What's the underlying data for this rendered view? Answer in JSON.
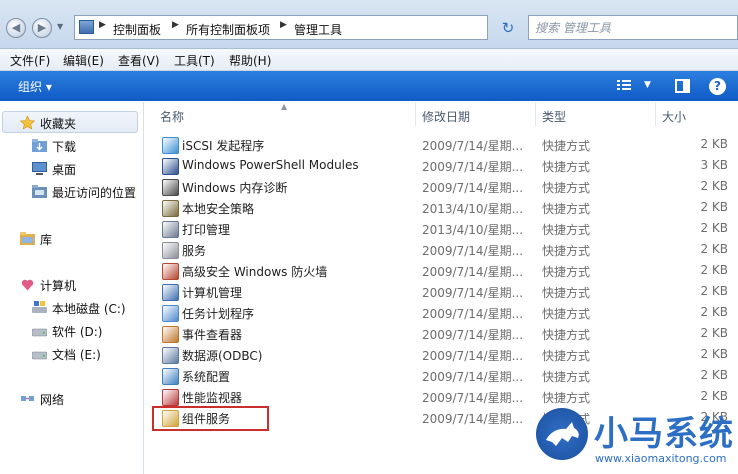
{
  "window": {
    "breadcrumb": [
      "控制面板",
      "所有控制面板项",
      "管理工具"
    ],
    "search_placeholder": "搜索 管理工具"
  },
  "menu": [
    "文件(F)",
    "编辑(E)",
    "查看(V)",
    "工具(T)",
    "帮助(H)"
  ],
  "toolbar": {
    "organize": "组织 ▾",
    "help": "?"
  },
  "sidebar": {
    "favorites": "收藏夹",
    "favorites_items": [
      "下载",
      "桌面",
      "最近访问的位置"
    ],
    "library": "库",
    "computer": "计算机",
    "drives": [
      "本地磁盘 (C:)",
      "软件 (D:)",
      "文档 (E:)"
    ],
    "network": "网络"
  },
  "columns": {
    "name": "名称",
    "date": "修改日期",
    "type": "类型",
    "size": "大小"
  },
  "files": [
    {
      "name": "iSCSI 发起程序",
      "date": "2009/7/14/星期...",
      "type": "快捷方式",
      "size": "2 KB",
      "icon": "globe-icon"
    },
    {
      "name": "Windows PowerShell Modules",
      "date": "2009/7/14/星期...",
      "type": "快捷方式",
      "size": "3 KB",
      "icon": "powershell-icon"
    },
    {
      "name": "Windows 内存诊断",
      "date": "2009/7/14/星期...",
      "type": "快捷方式",
      "size": "2 KB",
      "icon": "memory-icon"
    },
    {
      "name": "本地安全策略",
      "date": "2013/4/10/星期...",
      "type": "快捷方式",
      "size": "2 KB",
      "icon": "security-policy-icon"
    },
    {
      "name": "打印管理",
      "date": "2013/4/10/星期...",
      "type": "快捷方式",
      "size": "2 KB",
      "icon": "printer-icon"
    },
    {
      "name": "服务",
      "date": "2009/7/14/星期...",
      "type": "快捷方式",
      "size": "2 KB",
      "icon": "gear-icon"
    },
    {
      "name": "高级安全 Windows 防火墙",
      "date": "2009/7/14/星期...",
      "type": "快捷方式",
      "size": "2 KB",
      "icon": "firewall-icon"
    },
    {
      "name": "计算机管理",
      "date": "2009/7/14/星期...",
      "type": "快捷方式",
      "size": "2 KB",
      "icon": "computer-management-icon"
    },
    {
      "name": "任务计划程序",
      "date": "2009/7/14/星期...",
      "type": "快捷方式",
      "size": "2 KB",
      "icon": "clock-icon"
    },
    {
      "name": "事件查看器",
      "date": "2009/7/14/星期...",
      "type": "快捷方式",
      "size": "2 KB",
      "icon": "event-viewer-icon"
    },
    {
      "name": "数据源(ODBC)",
      "date": "2009/7/14/星期...",
      "type": "快捷方式",
      "size": "2 KB",
      "icon": "database-icon"
    },
    {
      "name": "系统配置",
      "date": "2009/7/14/星期...",
      "type": "快捷方式",
      "size": "2 KB",
      "icon": "system-config-icon"
    },
    {
      "name": "性能监视器",
      "date": "2009/7/14/星期...",
      "type": "快捷方式",
      "size": "2 KB",
      "icon": "performance-icon"
    },
    {
      "name": "组件服务",
      "date": "2009/7/14/星期...",
      "type": "快捷方式",
      "size": "2 KB",
      "icon": "component-services-icon"
    }
  ],
  "watermark": {
    "text": "小马系统",
    "url": "www.xiaomaxitong.com"
  },
  "colors": {
    "toolbar_blue": "#1466d0",
    "highlight_red": "#c9302c",
    "watermark_blue": "#2d6fc4"
  }
}
